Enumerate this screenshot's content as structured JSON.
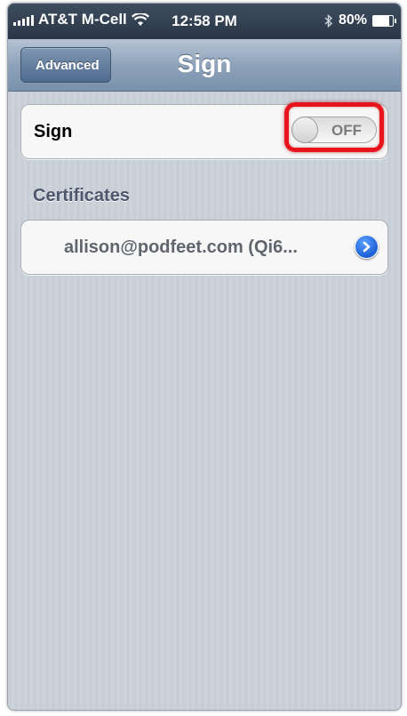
{
  "status_bar": {
    "carrier": "AT&T M-Cell",
    "time": "12:58 PM",
    "battery": "80%",
    "battery_level": 0.8,
    "icons": [
      "signal-bars-icon",
      "wifi-icon",
      "bluetooth-icon",
      "battery-icon"
    ]
  },
  "nav": {
    "back_label": "Advanced",
    "title": "Sign"
  },
  "sign_row": {
    "label": "Sign",
    "toggle_state": "OFF"
  },
  "certificates": {
    "header": "Certificates",
    "items": [
      {
        "label": "allison@podfeet.com (Qi6..."
      }
    ]
  },
  "colors": {
    "highlight": "#e8141b",
    "accent_blue": "#1c5fd6",
    "nav_bar": "#8ea3ba"
  }
}
